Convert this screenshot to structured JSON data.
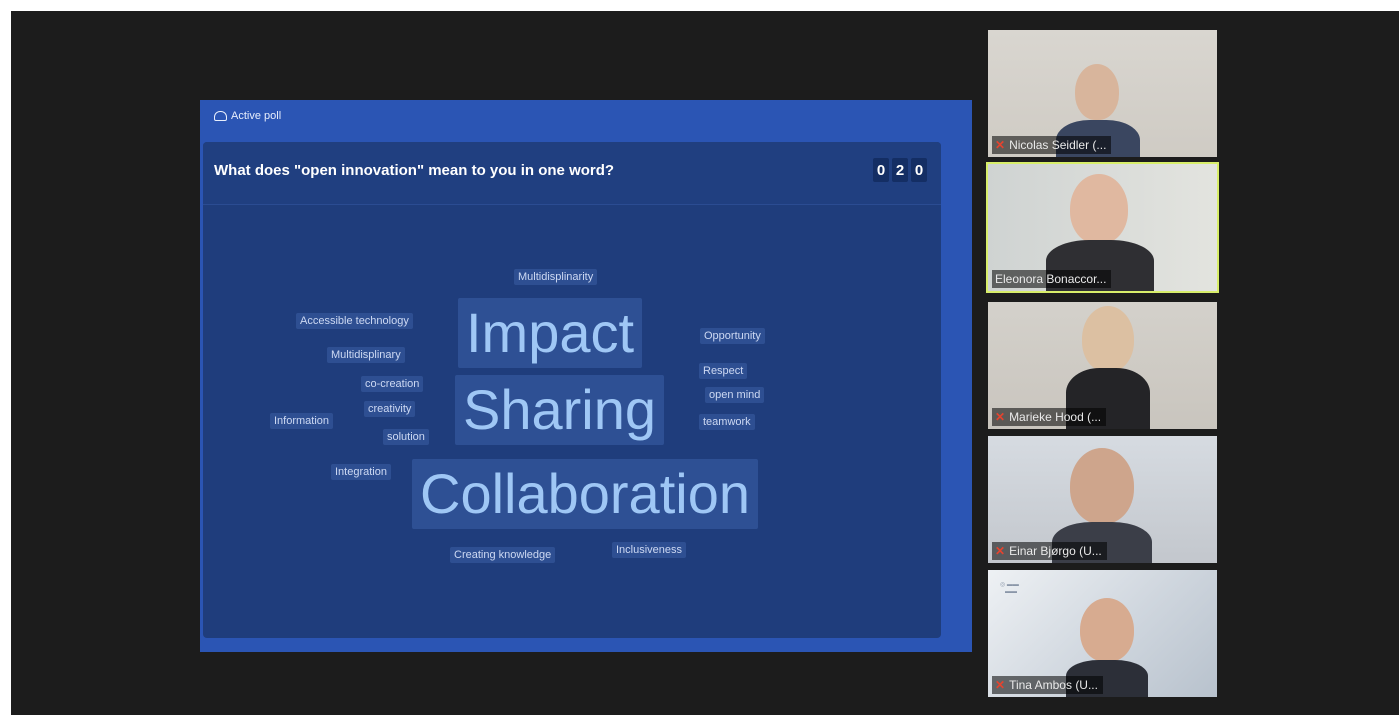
{
  "poll": {
    "tag_label": "Active poll",
    "question": "What does \"open innovation\" mean to you in one word?",
    "counter_digits": [
      "0",
      "2",
      "0"
    ]
  },
  "word_cloud": {
    "words": [
      "Multidisplinarity",
      "Accessible technology",
      "Multidisplinary",
      "co-creation",
      "creativity",
      "Information",
      "solution",
      "Integration",
      "Impact",
      "Sharing",
      "Collaboration",
      "Opportunity",
      "Respect",
      "open mind",
      "teamwork",
      "Creating knowledge",
      "Inclusiveness"
    ]
  },
  "participants": [
    {
      "name": "Nicolas Seidler (...",
      "muted": true,
      "active_speaker": false,
      "mic_icon": "muted-mic-icon"
    },
    {
      "name": "Eleonora Bonaccor...",
      "muted": false,
      "active_speaker": true,
      "accent": "#d8ee6a"
    },
    {
      "name": "Marieke Hood (...",
      "muted": true,
      "active_speaker": false,
      "mic_icon": "muted-mic-icon"
    },
    {
      "name": "Einar Bjørgo (U...",
      "muted": true,
      "active_speaker": false,
      "mic_icon": "muted-mic-icon"
    },
    {
      "name": "Tina Ambos (U...",
      "muted": true,
      "active_speaker": false,
      "mic_icon": "muted-mic-icon"
    }
  ],
  "colors": {
    "slide_bg": "#2b55b4",
    "card_bg": "#1f3d7c",
    "cloud_text": "#9fc7f5",
    "active_speaker_border": "#d8ee6a",
    "muted_mic": "#e5432e"
  }
}
